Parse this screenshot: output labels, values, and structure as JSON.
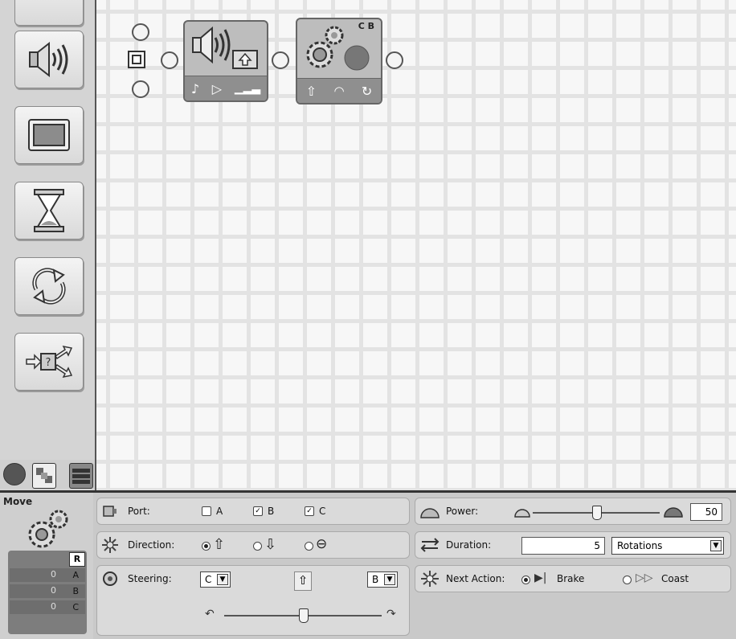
{
  "palette": {
    "items": [
      {
        "icon": "partial-block-icon"
      },
      {
        "icon": "sound-icon"
      },
      {
        "icon": "display-icon"
      },
      {
        "icon": "hourglass-wait-icon"
      },
      {
        "icon": "loop-icon"
      },
      {
        "icon": "switch-icon"
      }
    ],
    "tabs": [
      "common-palette",
      "complete-palette",
      "custom-palette"
    ]
  },
  "program": {
    "move_block_ports": "C B"
  },
  "config": {
    "block_name": "Move",
    "feedback": {
      "reset_label": "R",
      "rows": [
        {
          "value": "0",
          "port": "A"
        },
        {
          "value": "0",
          "port": "B"
        },
        {
          "value": "0",
          "port": "C"
        }
      ]
    },
    "port": {
      "label": "Port:",
      "options": [
        {
          "name": "A",
          "checked": false
        },
        {
          "name": "B",
          "checked": true
        },
        {
          "name": "C",
          "checked": true
        }
      ]
    },
    "direction": {
      "label": "Direction:",
      "selected": "forward"
    },
    "steering": {
      "label": "Steering:",
      "left_port": "C",
      "right_port": "B"
    },
    "power": {
      "label": "Power:",
      "value": "50",
      "level": 50
    },
    "duration": {
      "label": "Duration:",
      "value": "5",
      "unit": "Rotations"
    },
    "next_action": {
      "label": "Next Action:",
      "brake": "Brake",
      "coast": "Coast",
      "selected": "brake"
    }
  }
}
